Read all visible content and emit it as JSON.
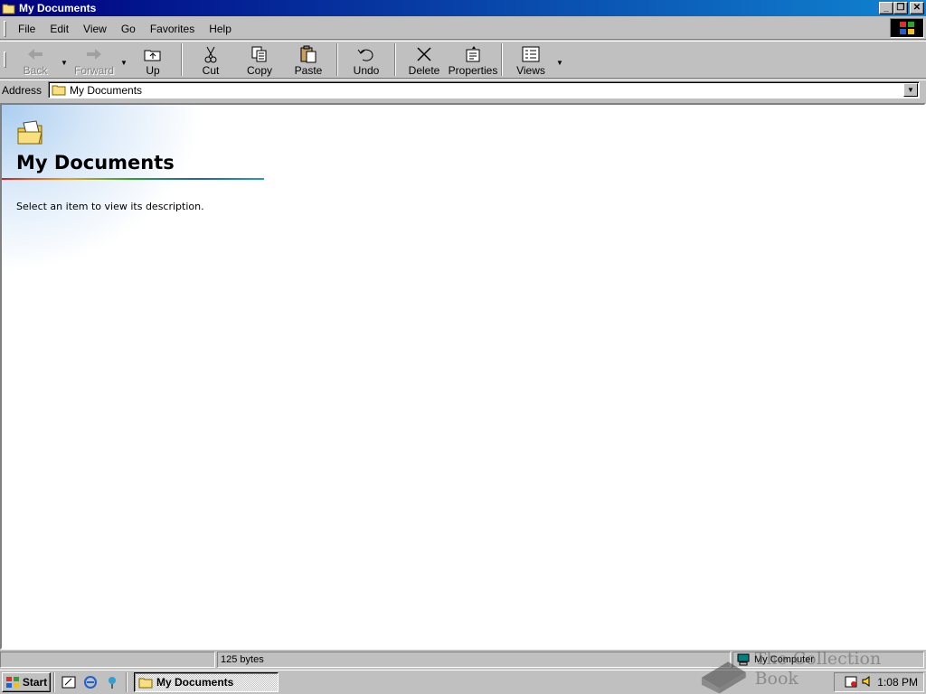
{
  "window": {
    "title": "My Documents"
  },
  "menu": [
    "File",
    "Edit",
    "View",
    "Go",
    "Favorites",
    "Help"
  ],
  "toolbar": {
    "back": "Back",
    "forward": "Forward",
    "up": "Up",
    "cut": "Cut",
    "copy": "Copy",
    "paste": "Paste",
    "undo": "Undo",
    "delete": "Delete",
    "properties": "Properties",
    "views": "Views"
  },
  "address": {
    "label": "Address",
    "value": "My Documents"
  },
  "content": {
    "heading": "My Documents",
    "description": "Select an item to view its description."
  },
  "status": {
    "left": "",
    "size": "125 bytes",
    "zone": "My Computer"
  },
  "taskbar": {
    "start": "Start",
    "task": "My Documents",
    "clock": "1:08 PM"
  },
  "watermark": "The Collection Book",
  "colors": {
    "titlebar_start": "#000080",
    "titlebar_end": "#1084d0",
    "face": "#c0c0c0"
  }
}
